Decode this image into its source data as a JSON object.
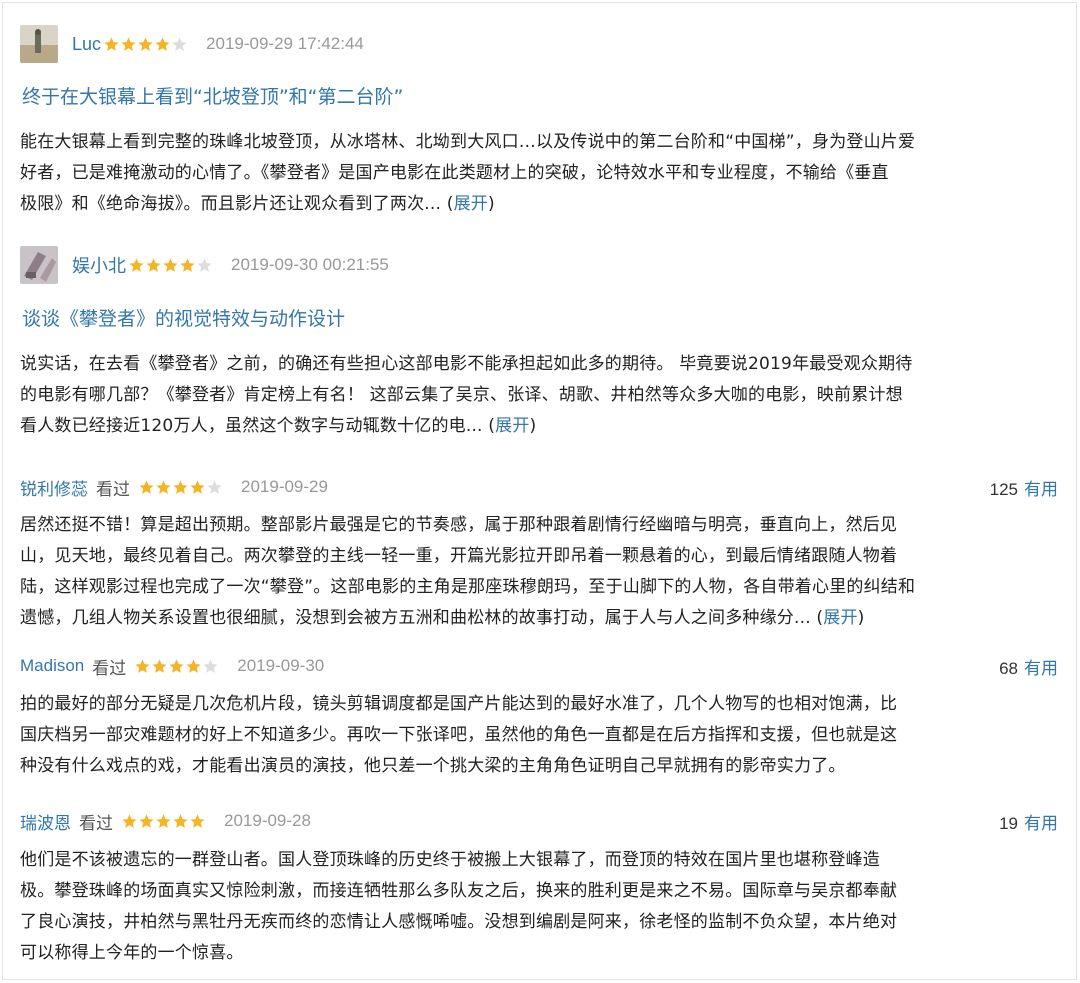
{
  "colors": {
    "link": "#3377aa",
    "star_on": "#f5b423",
    "star_off": "#dddddd",
    "meta": "#999999"
  },
  "long_reviews": [
    {
      "user": "Luc",
      "rating": 4,
      "time": "2019-09-29 17:42:44",
      "title": "终于在大银幕上看到“北坡登顶”和“第二台阶”",
      "lines": [
        "能在大银幕上看到完整的珠峰北坡登顶，从冰塔林、北坳到大风口…以及传说中的第二台阶和“中国梯”，身为登山片爱",
        "好者，已是难掩激动的心情了。《攀登者》是国产电影在此类题材上的突破，论特效水平和专业程度，不输给《垂直",
        "极限》和《绝命海拔》。而且影片还让观众看到了两次..."
      ],
      "expand": "展开"
    },
    {
      "user": "娱小北",
      "rating": 4,
      "time": "2019-09-30 00:21:55",
      "title": "谈谈《攀登者》的视觉特效与动作设计",
      "lines": [
        "说实话，在去看《攀登者》之前，的确还有些担心这部电影不能承担起如此多的期待。 毕竟要说2019年最受观众期待",
        "的电影有哪几部？《攀登者》肯定榜上有名！ 这部云集了吴京、张译、胡歌、井柏然等众多大咖的电影，映前累计想",
        "看人数已经接近120万人，虽然这个数字与动辄数十亿的电..."
      ],
      "expand": "展开"
    }
  ],
  "short_reviews": [
    {
      "user": "锐利修蕊",
      "status": "看过",
      "rating": 4,
      "date": "2019-09-29",
      "useful_count": "125",
      "useful_label": "有用",
      "lines": [
        "居然还挺不错！算是超出预期。整部影片最强是它的节奏感，属于那种跟着剧情行经幽暗与明亮，垂直向上，然后见",
        "山，见天地，最终见着自己。两次攀登的主线一轻一重，开篇光影拉开即吊着一颗悬着的心，到最后情绪跟随人物着",
        "陆，这样观影过程也完成了一次“攀登”。这部电影的主角是那座珠穆朗玛，至于山脚下的人物，各自带着心里的纠结和",
        "遗憾，几组人物关系设置也很细腻，没想到会被方五洲和曲松林的故事打动，属于人与人之间多种缘分..."
      ],
      "expand": "展开"
    },
    {
      "user": "Madison",
      "status": "看过",
      "rating": 4,
      "date": "2019-09-30",
      "useful_count": "68",
      "useful_label": "有用",
      "lines": [
        "拍的最好的部分无疑是几次危机片段，镜头剪辑调度都是国产片能达到的最好水准了，几个人物写的也相对饱满，比",
        "国庆档另一部灾难题材的好上不知道多少。再吹一下张译吧，虽然他的角色一直都是在后方指挥和支援，但也就是这",
        "种没有什么戏点的戏，才能看出演员的演技，他只差一个挑大梁的主角角色证明自己早就拥有的影帝实力了。"
      ]
    },
    {
      "user": "瑞波恩",
      "status": "看过",
      "rating": 5,
      "date": "2019-09-28",
      "useful_count": "19",
      "useful_label": "有用",
      "lines": [
        "他们是不该被遗忘的一群登山者。国人登顶珠峰的历史终于被搬上大银幕了，而登顶的特效在国片里也堪称登峰造",
        "极。攀登珠峰的场面真实又惊险刺激，而接连牺牲那么多队友之后，换来的胜利更是来之不易。国际章与吴京都奉献",
        "了良心演技，井柏然与黑牡丹无疾而终的恋情让人感慨唏嘘。没想到编剧是阿来，徐老怪的监制不负众望，本片绝对",
        "可以称得上今年的一个惊喜。"
      ]
    }
  ]
}
